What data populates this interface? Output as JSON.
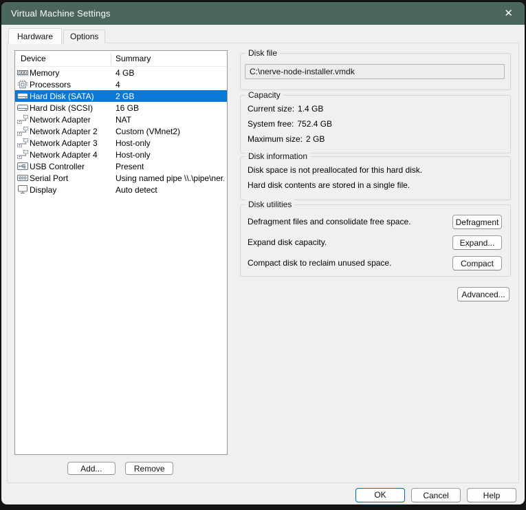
{
  "window": {
    "title": "Virtual Machine Settings",
    "close_glyph": "✕"
  },
  "tabs": [
    {
      "label": "Hardware",
      "active": true
    },
    {
      "label": "Options",
      "active": false
    }
  ],
  "device_list": {
    "columns": [
      "Device",
      "Summary"
    ],
    "rows": [
      {
        "icon": "memory-icon",
        "device": "Memory",
        "summary": "4 GB",
        "selected": false
      },
      {
        "icon": "processor-icon",
        "device": "Processors",
        "summary": "4",
        "selected": false
      },
      {
        "icon": "hard-disk-icon",
        "device": "Hard Disk (SATA)",
        "summary": "2 GB",
        "selected": true
      },
      {
        "icon": "hard-disk-icon",
        "device": "Hard Disk (SCSI)",
        "summary": "16 GB",
        "selected": false
      },
      {
        "icon": "network-adapter-icon",
        "device": "Network Adapter",
        "summary": "NAT",
        "selected": false
      },
      {
        "icon": "network-adapter-icon",
        "device": "Network Adapter 2",
        "summary": "Custom (VMnet2)",
        "selected": false
      },
      {
        "icon": "network-adapter-icon",
        "device": "Network Adapter 3",
        "summary": "Host-only",
        "selected": false
      },
      {
        "icon": "network-adapter-icon",
        "device": "Network Adapter 4",
        "summary": "Host-only",
        "selected": false
      },
      {
        "icon": "usb-controller-icon",
        "device": "USB Controller",
        "summary": "Present",
        "selected": false
      },
      {
        "icon": "serial-port-icon",
        "device": "Serial Port",
        "summary": "Using named pipe \\\\.\\pipe\\ner...",
        "selected": false
      },
      {
        "icon": "display-icon",
        "device": "Display",
        "summary": "Auto detect",
        "selected": false
      }
    ]
  },
  "list_buttons": {
    "add": "Add...",
    "remove": "Remove"
  },
  "disk_file": {
    "label": "Disk file",
    "path": "C:\\nerve-node-installer.vmdk"
  },
  "capacity": {
    "label": "Capacity",
    "rows": [
      {
        "label": "Current size:",
        "value": "1.4 GB"
      },
      {
        "label": "System free:",
        "value": "752.4 GB"
      },
      {
        "label": "Maximum size:",
        "value": "2 GB"
      }
    ]
  },
  "disk_information": {
    "label": "Disk information",
    "lines": [
      "Disk space is not preallocated for this hard disk.",
      "Hard disk contents are stored in a single file."
    ]
  },
  "disk_utilities": {
    "label": "Disk utilities",
    "rows": [
      {
        "description": "Defragment files and consolidate free space.",
        "button": "Defragment"
      },
      {
        "description": "Expand disk capacity.",
        "button": "Expand..."
      },
      {
        "description": "Compact disk to reclaim unused space.",
        "button": "Compact"
      }
    ]
  },
  "advanced_button": "Advanced...",
  "dialog_buttons": {
    "ok": "OK",
    "cancel": "Cancel",
    "help": "Help"
  },
  "colors": {
    "title_bar": "#4b665e",
    "selection": "#0a78d7",
    "ok_border": "#0067c0",
    "dialog_bg": "#f0f0f0"
  }
}
